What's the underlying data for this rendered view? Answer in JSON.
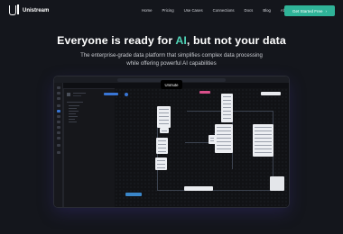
{
  "brand": {
    "name": "Unistream"
  },
  "nav": {
    "items": [
      "Home",
      "Pricing",
      "Use Cases",
      "Connections",
      "Docs",
      "Blog",
      "About Us"
    ],
    "cta": "Get Started Free"
  },
  "hero": {
    "title_before": "Everyone is ready for ",
    "title_accent": "AI",
    "title_after": ", but not your data",
    "subtitle_line1": "The enterprise-grade data platform that simplifies complex data processing",
    "subtitle_line2": "while offering powerful AI capabilities"
  },
  "video": {
    "unmute_label": "Unmute"
  },
  "colors": {
    "accent": "#4fd1b5",
    "cta_bg": "#2fb398",
    "page_bg": "#14161c"
  }
}
